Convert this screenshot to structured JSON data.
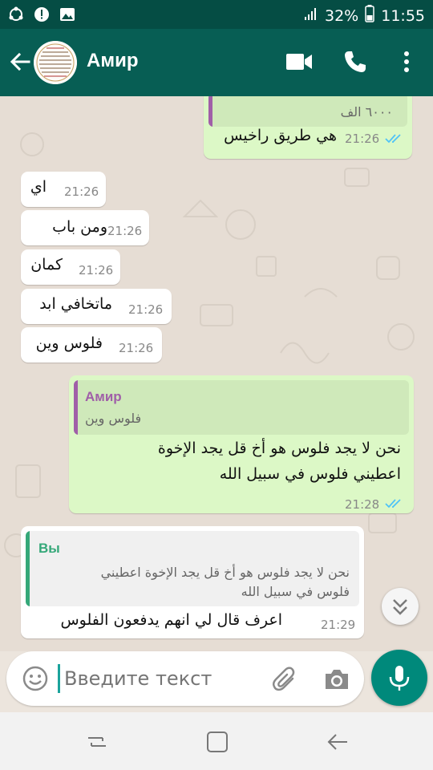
{
  "status_bar": {
    "battery": "32%",
    "time": "11:55"
  },
  "header": {
    "contact_name": "Амир"
  },
  "messages": {
    "m0": {
      "quote_text": "٦٠٠٠ الف",
      "text": "هي طريق راخيس",
      "time": "21:26"
    },
    "m1": {
      "text": "اي",
      "time": "21:26"
    },
    "m2": {
      "text": "ومن باب",
      "time": "21:26"
    },
    "m3": {
      "text": "كمان",
      "time": "21:26"
    },
    "m4": {
      "text": "ماتخافي ابد",
      "time": "21:26"
    },
    "m5": {
      "text": "فلوس وين",
      "time": "21:26"
    },
    "m6": {
      "quote_author": "Амир",
      "quote_text": "فلوس وين",
      "line1": "نحن لا يجد فلوس هو أخ قل يجد الإخوة",
      "line2": "اعطيني فلوس في سبيل الله",
      "time": "21:28"
    },
    "m7": {
      "quote_author": "Вы",
      "quote_line1": "نحن لا يجد فلوس هو أخ قل يجد الإخوة اعطيني",
      "quote_line2": "فلوس في سبيل الله",
      "text": "اعرف قال لي انهم يدفعون الفلوس",
      "time": "21:29"
    }
  },
  "composer": {
    "placeholder": "Введите текст"
  },
  "colors": {
    "header": "#075e54",
    "status": "#054d44",
    "outgoing": "#dcf8c6",
    "incoming": "#ffffff",
    "accent": "#00897b",
    "read_ticks": "#4fc3f7",
    "quote_author_contact": "#a05fa8",
    "quote_author_self": "#35a879"
  }
}
